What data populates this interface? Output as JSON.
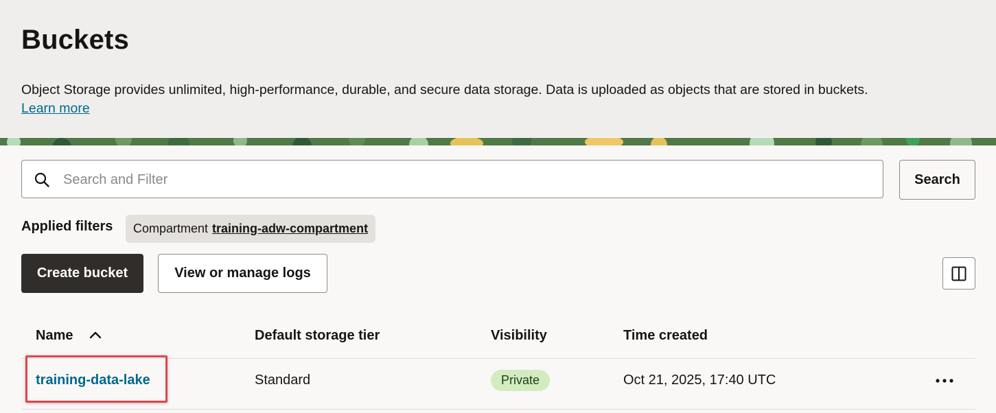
{
  "header": {
    "title": "Buckets",
    "description": "Object Storage provides unlimited, high-performance, durable, and secure data storage. Data is uploaded as objects that are stored in buckets.",
    "learn_more": "Learn more"
  },
  "search": {
    "placeholder": "Search and Filter",
    "value": "",
    "button_label": "Search",
    "icon": "search-icon"
  },
  "filters": {
    "label": "Applied filters",
    "chips": [
      {
        "name": "Compartment",
        "value": "training-adw-compartment"
      }
    ]
  },
  "toolbar": {
    "create_label": "Create bucket",
    "logs_label": "View or manage logs",
    "panel_icon": "panel-toggle-icon"
  },
  "table": {
    "columns": [
      "Name",
      "Default storage tier",
      "Visibility",
      "Time created"
    ],
    "sort": {
      "column": "Name",
      "direction": "ascending"
    },
    "rows": [
      {
        "name": "training-data-lake",
        "tier": "Standard",
        "visibility": "Private",
        "time_created": "Oct 21, 2025, 17:40 UTC"
      }
    ]
  },
  "colors": {
    "accent_link": "#00688c",
    "primary_button": "#312d2a",
    "badge_private": "#d2ebc1",
    "highlight": "#e0464d"
  }
}
